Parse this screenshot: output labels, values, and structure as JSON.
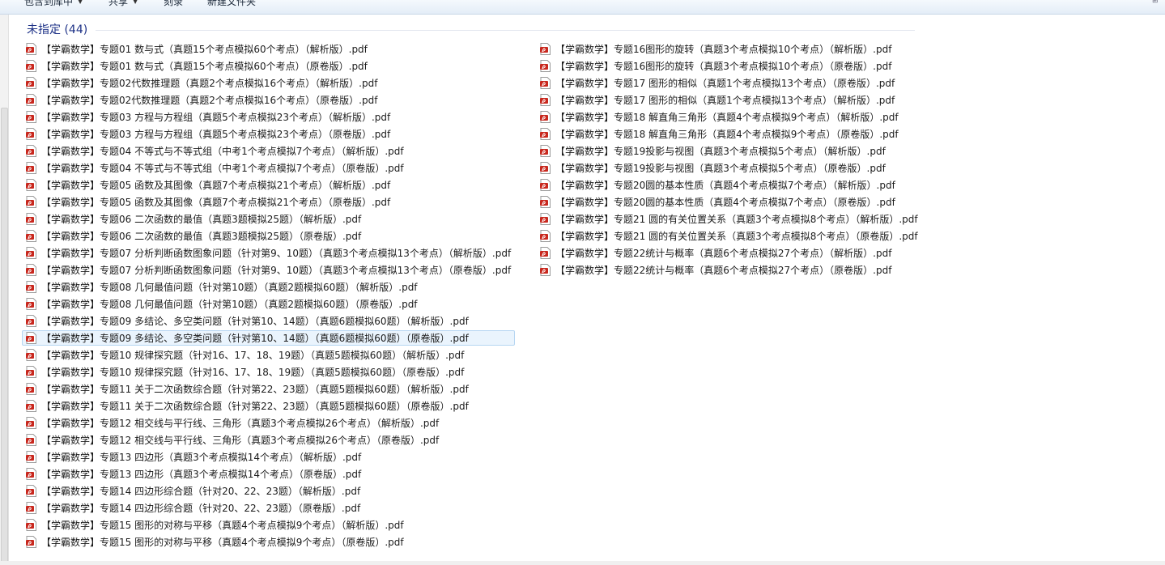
{
  "toolbar": {
    "items": [
      {
        "label": "包含到库中"
      },
      {
        "label": "共享"
      },
      {
        "label": "刻录"
      },
      {
        "label": "新建文件夹"
      }
    ]
  },
  "group": {
    "title": "未指定 (44)"
  },
  "colors": {
    "group_title": "#1e3287",
    "selection_bg": "#eaf4fd",
    "selection_border": "#b6d6f2",
    "pdf_icon": "#c8281e"
  },
  "icons": {
    "file": "pdf-icon"
  },
  "files": {
    "left": [
      "【学霸数学】专题01 数与式（真题15个考点模拟60个考点）（解析版）.pdf",
      "【学霸数学】专题01 数与式（真题15个考点模拟60个考点）（原卷版）.pdf",
      "【学霸数学】专题02代数推理题（真题2个考点模拟16个考点）（解析版）.pdf",
      "【学霸数学】专题02代数推理题（真题2个考点模拟16个考点）（原卷版）.pdf",
      "【学霸数学】专题03 方程与方程组（真题5个考点模拟23个考点）（解析版）.pdf",
      "【学霸数学】专题03 方程与方程组（真题5个考点模拟23个考点）（原卷版）.pdf",
      "【学霸数学】专题04 不等式与不等式组（中考1个考点模拟7个考点）（解析版）.pdf",
      "【学霸数学】专题04 不等式与不等式组（中考1个考点模拟7个考点）（原卷版）.pdf",
      "【学霸数学】专题05 函数及其图像（真题7个考点模拟21个考点）（解析版）.pdf",
      "【学霸数学】专题05 函数及其图像（真题7个考点模拟21个考点）（原卷版）.pdf",
      "【学霸数学】专题06 二次函数的最值（真题3题模拟25题）（解析版）.pdf",
      "【学霸数学】专题06 二次函数的最值（真题3题模拟25题）（原卷版）.pdf",
      "【学霸数学】专题07 分析判断函数图象问题（针对第9、10题）（真题3个考点模拟13个考点）（解析版）.pdf",
      "【学霸数学】专题07 分析判断函数图象问题（针对第9、10题）（真题3个考点模拟13个考点）（原卷版）.pdf",
      "【学霸数学】专题08 几何最值问题（针对第10题）（真题2题模拟60题）（解析版）.pdf",
      "【学霸数学】专题08 几何最值问题（针对第10题）（真题2题模拟60题）（原卷版）.pdf",
      "【学霸数学】专题09 多结论、多空类问题（针对第10、14题）（真题6题模拟60题）（解析版）.pdf",
      "【学霸数学】专题09 多结论、多空类问题（针对第10、14题）（真题6题模拟60题）（原卷版）.pdf",
      "【学霸数学】专题10 规律探究题（针对16、17、18、19题）（真题5题模拟60题）（解析版）.pdf",
      "【学霸数学】专题10 规律探究题（针对16、17、18、19题）（真题5题模拟60题）（原卷版）.pdf",
      "【学霸数学】专题11 关于二次函数综合题（针对第22、23题）（真题5题模拟60题）（解析版）.pdf",
      "【学霸数学】专题11 关于二次函数综合题（针对第22、23题）（真题5题模拟60题）（原卷版）.pdf",
      "【学霸数学】专题12 相交线与平行线、三角形（真题3个考点模拟26个考点）（解析版）.pdf",
      "【学霸数学】专题12 相交线与平行线、三角形（真题3个考点模拟26个考点）（原卷版）.pdf",
      "【学霸数学】专题13 四边形（真题3个考点模拟14个考点）（解析版）.pdf",
      "【学霸数学】专题13 四边形（真题3个考点模拟14个考点）（原卷版）.pdf",
      "【学霸数学】专题14 四边形综合题（针对20、22、23题）（解析版）.pdf",
      "【学霸数学】专题14 四边形综合题（针对20、22、23题）（原卷版）.pdf",
      "【学霸数学】专题15 图形的对称与平移（真题4个考点模拟9个考点）（解析版）.pdf",
      "【学霸数学】专题15 图形的对称与平移（真题4个考点模拟9个考点）（原卷版）.pdf"
    ],
    "right": [
      "【学霸数学】专题16图形的旋转（真题3个考点模拟10个考点）（解析版）.pdf",
      "【学霸数学】专题16图形的旋转（真题3个考点模拟10个考点）（原卷版）.pdf",
      "【学霸数学】专题17 图形的相似（真题1个考点模拟13个考点）（原卷版）.pdf",
      "【学霸数学】专题17 图形的相似（真题1个考点模拟13个考点）（解析版）.pdf",
      "【学霸数学】专题18 解直角三角形（真题4个考点模拟9个考点）（解析版）.pdf",
      "【学霸数学】专题18 解直角三角形（真题4个考点模拟9个考点）（原卷版）.pdf",
      "【学霸数学】专题19投影与视图（真题3个考点模拟5个考点）（解析版）.pdf",
      "【学霸数学】专题19投影与视图（真题3个考点模拟5个考点）（原卷版）.pdf",
      "【学霸数学】专题20圆的基本性质（真题4个考点模拟7个考点）（解析版）.pdf",
      "【学霸数学】专题20圆的基本性质（真题4个考点模拟7个考点）（原卷版）.pdf",
      "【学霸数学】专题21 圆的有关位置关系（真题3个考点模拟8个考点）（解析版）.pdf",
      "【学霸数学】专题21 圆的有关位置关系（真题3个考点模拟8个考点）（原卷版）.pdf",
      "【学霸数学】专题22统计与概率（真题6个考点模拟27个考点）（解析版）.pdf",
      "【学霸数学】专题22统计与概率（真题6个考点模拟27个考点）（原卷版）.pdf"
    ]
  },
  "selected": {
    "column": "left",
    "index": 17
  }
}
